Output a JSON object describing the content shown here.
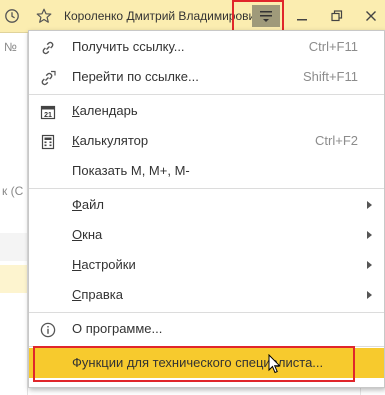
{
  "titlebar": {
    "user_name": "Короленко Дмитрий Владимирович",
    "icons": [
      "history-icon",
      "star-icon",
      "main-menu-icon",
      "minimize-icon",
      "restore-icon",
      "close-icon"
    ]
  },
  "background": {
    "left_fragment": "№",
    "search_fragment": "к (С"
  },
  "menu": {
    "items": [
      {
        "label": "Получить ссылку...",
        "shortcut": "Ctrl+F11",
        "icon": "link-icon"
      },
      {
        "label": "Перейти по ссылке...",
        "shortcut": "Shift+F11",
        "icon": "follow-link-icon"
      },
      {
        "label": "Календарь",
        "icon": "calendar-icon",
        "icon_text": "21"
      },
      {
        "label": "Калькулятор",
        "shortcut": "Ctrl+F2",
        "icon": "calculator-icon"
      },
      {
        "label": "Показать М, М+, М-"
      },
      {
        "label": "Файл",
        "submenu": true
      },
      {
        "label": "Окна",
        "submenu": true
      },
      {
        "label": "Настройки",
        "submenu": true
      },
      {
        "label": "Справка",
        "submenu": true
      },
      {
        "label": "О программе...",
        "icon": "info-icon"
      },
      {
        "label": "Функции для технического специалиста...",
        "selected": true
      }
    ]
  },
  "colors": {
    "titlebar_bg": "#fbedb0",
    "selected_item_bg": "#f7ca2d",
    "annotation_red": "#e0262b",
    "menu_button_bg": "#9f9a7a"
  }
}
